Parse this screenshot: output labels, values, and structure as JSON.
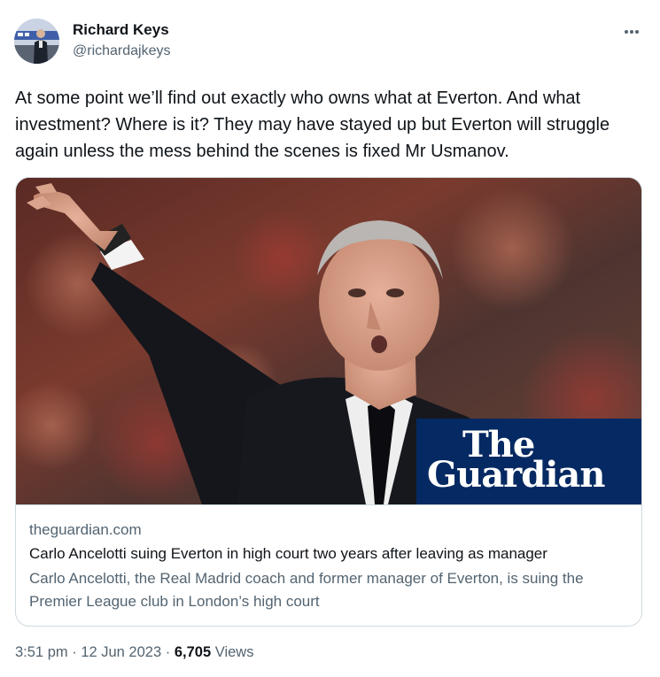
{
  "author": {
    "name": "Richard Keys",
    "handle": "@richardajkeys"
  },
  "tweet": {
    "text": "At some point we’ll find out exactly who owns what at Everton. And what investment? Where is it? They may have stayed up but Everton will struggle again unless the mess behind the scenes is fixed Mr Usmanov."
  },
  "card": {
    "logo_line1": "The",
    "logo_line2": "Guardian",
    "domain": "theguardian.com",
    "title": "Carlo Ancelotti suing Everton in high court two years after leaving as manager",
    "description": "Carlo Ancelotti, the Real Madrid coach and former manager of Everton, is suing the Premier League club in London’s high court"
  },
  "meta": {
    "time": "3:51 pm",
    "separator1": "·",
    "date": "12 Jun 2023",
    "separator2": "·",
    "views_count": "6,705",
    "views_label": "Views"
  },
  "icons": {
    "more": "more-horizontal-icon"
  },
  "colors": {
    "text_primary": "#0f1419",
    "text_secondary": "#536471",
    "border": "#cfd9de",
    "guardian_blue": "#052962"
  }
}
